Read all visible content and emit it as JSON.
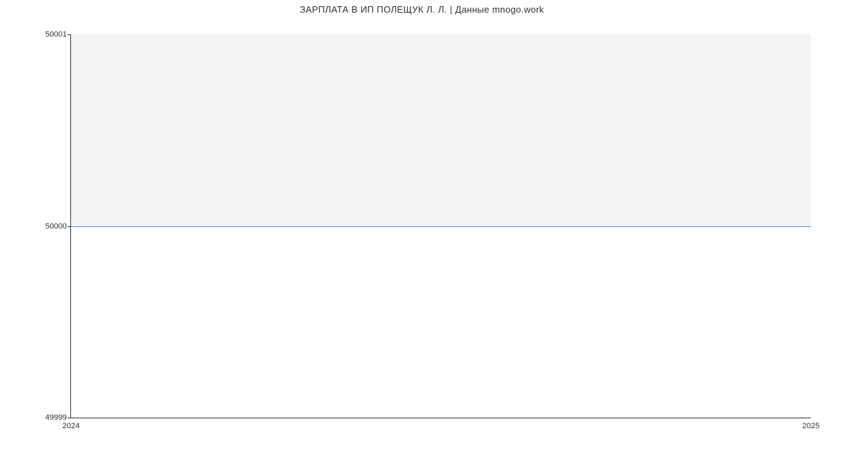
{
  "chart_data": {
    "type": "line",
    "title": "ЗАРПЛАТА В ИП ПОЛЕЩУК Л. Л. | Данные mnogo.work",
    "x": [
      2024,
      2025
    ],
    "values": [
      50000,
      50000
    ],
    "xlabel": "",
    "ylabel": "",
    "xlim": [
      2024,
      2025
    ],
    "ylim": [
      49999,
      50001
    ],
    "y_ticks": [
      49999,
      50000,
      50001
    ],
    "x_ticks": [
      2024,
      2025
    ],
    "grid": false,
    "fill_above_baseline": true,
    "fill_color": "#f3f3f3",
    "line_color": "#5b8fd6"
  },
  "labels": {
    "ytick0": "49999",
    "ytick1": "50000",
    "ytick2": "50001",
    "xtick0": "2024",
    "xtick1": "2025"
  }
}
